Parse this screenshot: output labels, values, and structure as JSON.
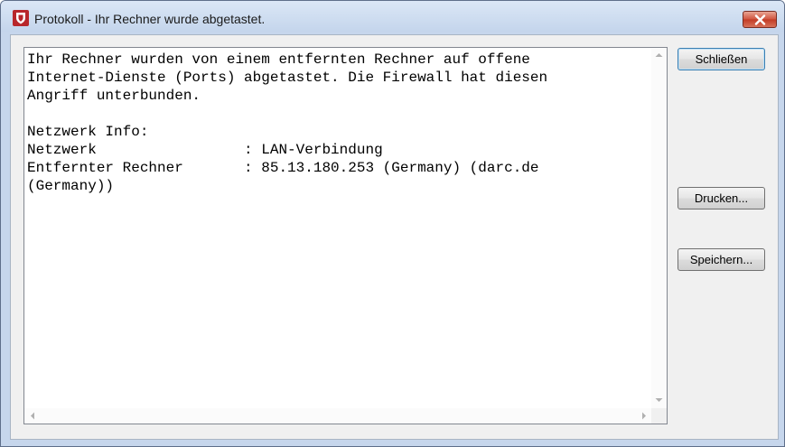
{
  "window": {
    "title": "Protokoll - Ihr Rechner wurde abgetastet.",
    "app_icon": "shield-icon",
    "close_icon": "close-icon"
  },
  "log": {
    "lines": [
      "Ihr Rechner wurden von einem entfernten Rechner auf offene",
      "Internet-Dienste (Ports) abgetastet. Die Firewall hat diesen",
      "Angriff unterbunden.",
      "",
      "Netzwerk Info:",
      "Netzwerk                 : LAN-Verbindung",
      "Entfernter Rechner       : 85.13.180.253 (Germany) (darc.de",
      "(Germany))"
    ]
  },
  "buttons": {
    "close_label": "Schließen",
    "print_label": "Drucken...",
    "save_label": "Speichern..."
  },
  "colors": {
    "title_bar": "#c4d5ec",
    "close_button": "#c23b24",
    "dialog_background": "#f0f0f0"
  }
}
